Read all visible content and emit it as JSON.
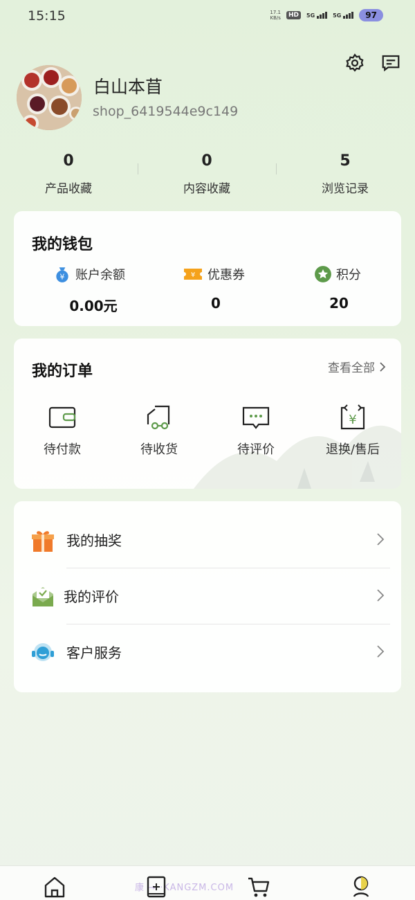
{
  "status_bar": {
    "time": "15:15",
    "net_speed_value": "17.1",
    "net_speed_unit": "KB/s",
    "hd_label": "HD",
    "sim1_label": "5G",
    "sim2_label": "5G",
    "battery": "97"
  },
  "profile": {
    "shop_name": "白山本苜",
    "shop_id": "shop_6419544e9c149"
  },
  "stats": [
    {
      "value": "0",
      "label": "产品收藏"
    },
    {
      "value": "0",
      "label": "内容收藏"
    },
    {
      "value": "5",
      "label": "浏览记录"
    }
  ],
  "wallet": {
    "title": "我的钱包",
    "items": [
      {
        "label": "账户余额",
        "value": "0.00元",
        "icon": "money-bag-icon",
        "color": "#3d8fe0"
      },
      {
        "label": "优惠券",
        "value": "0",
        "icon": "coupon-icon",
        "color": "#f5a21b"
      },
      {
        "label": "积分",
        "value": "20",
        "icon": "points-star-icon",
        "color": "#5d9a4a"
      }
    ]
  },
  "orders": {
    "title": "我的订单",
    "view_all": "查看全部",
    "items": [
      {
        "label": "待付款",
        "icon": "wallet-icon"
      },
      {
        "label": "待收货",
        "icon": "delivery-icon"
      },
      {
        "label": "待评价",
        "icon": "comment-icon"
      },
      {
        "label": "退换/售后",
        "icon": "refund-icon"
      }
    ]
  },
  "menu": [
    {
      "label": "我的抽奖",
      "icon": "gift-icon",
      "color": "#f07a2a"
    },
    {
      "label": "我的评价",
      "icon": "review-envelope-icon",
      "color": "#7aaa4e"
    },
    {
      "label": "客户服务",
      "icon": "headset-icon",
      "color": "#2f9fd6"
    }
  ],
  "nav": {
    "watermark": "康 → ·KANGZM.COM"
  },
  "colors": {
    "accent_green": "#5d9a4a",
    "background": "#e7f2e0"
  }
}
